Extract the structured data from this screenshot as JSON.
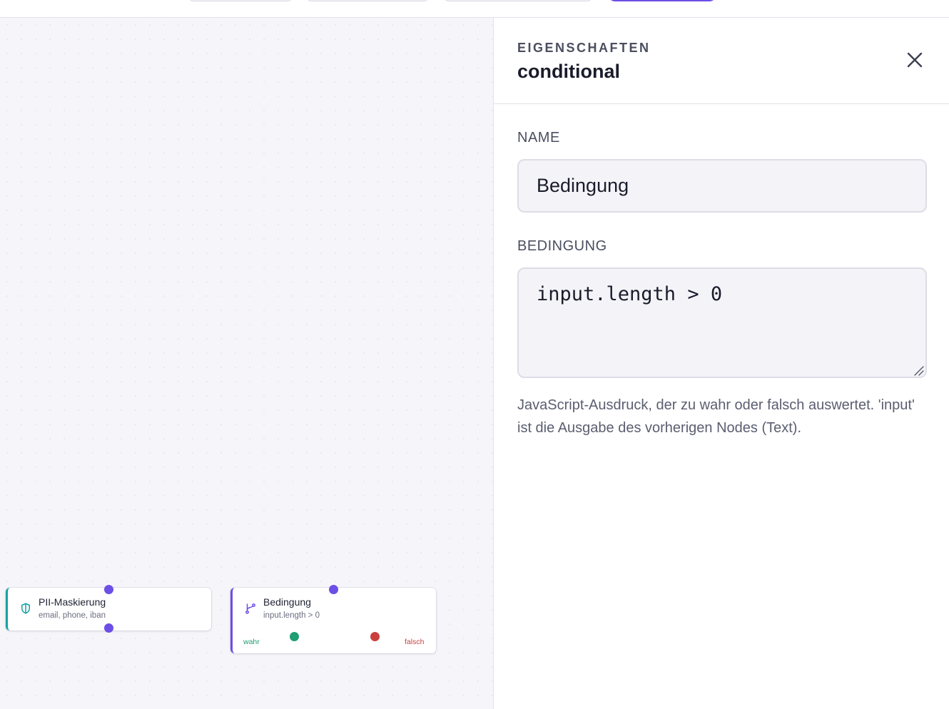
{
  "toolbar": {
    "buttons": [
      "",
      "",
      "",
      ""
    ]
  },
  "canvas": {
    "nodes": [
      {
        "type": "pii",
        "title": "PII-Maskierung",
        "subtitle": "email, phone, iban",
        "icon": "shield-icon",
        "accent": "#14a3a3"
      },
      {
        "type": "conditional",
        "title": "Bedingung",
        "subtitle": "input.length > 0",
        "icon": "branch-icon",
        "accent": "#6d4ee6",
        "true_label": "wahr",
        "false_label": "falsch"
      }
    ]
  },
  "panel": {
    "kicker": "EIGENSCHAFTEN",
    "title": "conditional",
    "close_icon": "close-icon",
    "name_label": "NAME",
    "name_value": "Bedingung",
    "condition_label": "BEDINGUNG",
    "condition_value": "input.length > 0",
    "help_text": "JavaScript-Ausdruck, der zu wahr oder falsch auswertet. 'input' ist die Ausgabe des vorherigen Nodes (Text)."
  },
  "colors": {
    "accent": "#6d4ee6",
    "teal": "#14a3a3",
    "true": "#1f9d73",
    "false": "#c9403f"
  }
}
